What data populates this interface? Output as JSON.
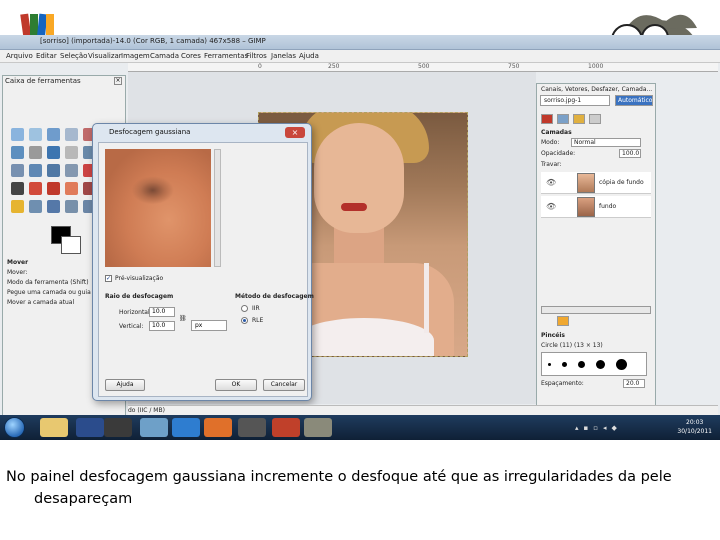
{
  "gimp": {
    "title_bar": "[sorriso] (importada)-14.0 (Cor RGB, 1 camada) 467x588 – GIMP",
    "menu": [
      "Arquivo",
      "Editar",
      "Seleção",
      "Visualizar",
      "Imagem",
      "Camada",
      "Cores",
      "Ferramentas",
      "Filtros",
      "Janelas",
      "Ajuda"
    ],
    "ruler_labels": [
      "0",
      "250",
      "500",
      "750",
      "1000"
    ],
    "status": "do (IIC / MB)"
  },
  "toolbox": {
    "title": "Caixa de ferramentas",
    "options_title": "Mover",
    "option_mover": "Mover:",
    "option_tool_toggle": "Modo da ferramenta (Shift)",
    "option_pick_layer": "Pegue uma camada ou guia",
    "option_move_active": "Mover a camada atual"
  },
  "dialog": {
    "title": "Desfocagem gaussiana",
    "preview_label": "Pré-visualização",
    "blur_radius_label": "Raio de desfocagem",
    "horizontal_label": "Horizontal:",
    "horizontal_value": "10.0",
    "vertical_label": "Vertical:",
    "vertical_value": "10.0",
    "unit": "px",
    "method_label": "Método de desfocagem",
    "method_iir": "IIR",
    "method_rle": "RLE",
    "help_button": "Ajuda",
    "ok_button": "OK",
    "cancel_button": "Cancelar"
  },
  "dock": {
    "tabs_title": "Canais, Vetores, Desfazer, Camada...",
    "image_select": "sorriso.jpg-1",
    "auto_button": "Automático",
    "layers_label": "Camadas",
    "mode_label": "Modo:",
    "mode_value": "Normal",
    "opacity_label": "Opacidade:",
    "opacity_value": "100.0",
    "lock_label": "Travar:",
    "layer_1": "cópia de fundo",
    "layer_2": "fundo",
    "brushes_label": "Pincéis",
    "brush_name": "Circle (11) (13 × 13)",
    "spacing_label": "Espaçamento:",
    "spacing_value": "20.0"
  },
  "taskbar": {
    "time": "20:03",
    "date": "30/10/2011"
  },
  "caption": {
    "line1": "No painel desfocagem gaussiana incremente o desfoque até que as irregularidades da pele",
    "line2": "desapareçam"
  },
  "colors": {
    "dialog_frame": "#dde6f0",
    "taskbar": "#1f3c5e",
    "lips": "#b3302a"
  }
}
